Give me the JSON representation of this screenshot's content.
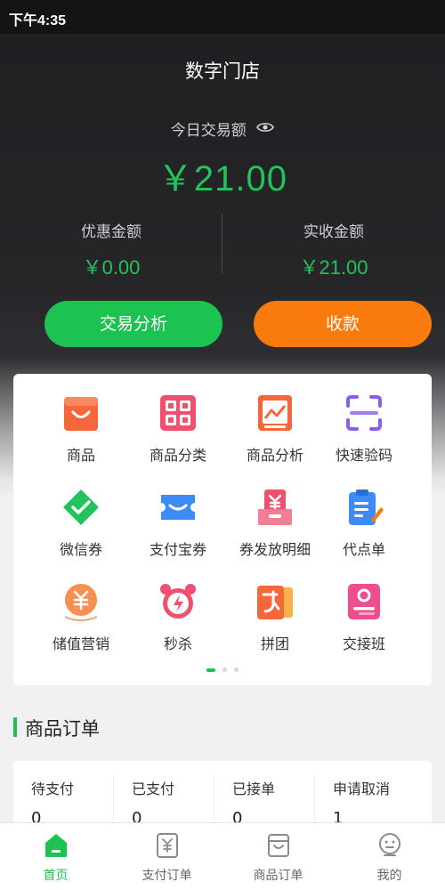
{
  "status_bar": {
    "time": "下午4:35"
  },
  "header": {
    "title": "数字门店",
    "today_label": "今日交易额",
    "today_amount": "￥21.00",
    "discount_label": "优惠金额",
    "discount_value": "￥0.00",
    "received_label": "实收金额",
    "received_value": "￥21.00"
  },
  "actions": {
    "analysis_label": "交易分析",
    "collect_label": "收款"
  },
  "grid": {
    "items": [
      {
        "label": "商品",
        "icon": "shopping-bag-icon"
      },
      {
        "label": "商品分类",
        "icon": "category-grid-icon"
      },
      {
        "label": "商品分析",
        "icon": "analysis-chart-icon"
      },
      {
        "label": "快速验码",
        "icon": "scan-icon"
      },
      {
        "label": "微信券",
        "icon": "wechat-coupon-icon"
      },
      {
        "label": "支付宝券",
        "icon": "alipay-coupon-icon"
      },
      {
        "label": "券发放明细",
        "icon": "coupon-detail-icon"
      },
      {
        "label": "代点单",
        "icon": "order-clipboard-icon"
      },
      {
        "label": "储值营销",
        "icon": "stored-value-icon"
      },
      {
        "label": "秒杀",
        "icon": "alarm-clock-icon"
      },
      {
        "label": "拼团",
        "icon": "group-buy-icon"
      },
      {
        "label": "交接班",
        "icon": "shift-handover-icon"
      }
    ],
    "page": 1,
    "page_count": 3
  },
  "orders": {
    "section_title": "商品订单",
    "columns": [
      {
        "label": "待支付",
        "value": "0"
      },
      {
        "label": "已支付",
        "value": "0"
      },
      {
        "label": "已接单",
        "value": "0"
      },
      {
        "label": "申请取消",
        "value": "1"
      }
    ]
  },
  "tabs": [
    {
      "label": "首页",
      "icon": "home-icon",
      "active": true
    },
    {
      "label": "支付订单",
      "icon": "payment-order-icon",
      "active": false
    },
    {
      "label": "商品订单",
      "icon": "goods-order-icon",
      "active": false
    },
    {
      "label": "我的",
      "icon": "profile-icon",
      "active": false
    }
  ],
  "colors": {
    "accent_green": "#1cc350",
    "accent_orange": "#fa7b0d",
    "header_bg": "#262629"
  }
}
